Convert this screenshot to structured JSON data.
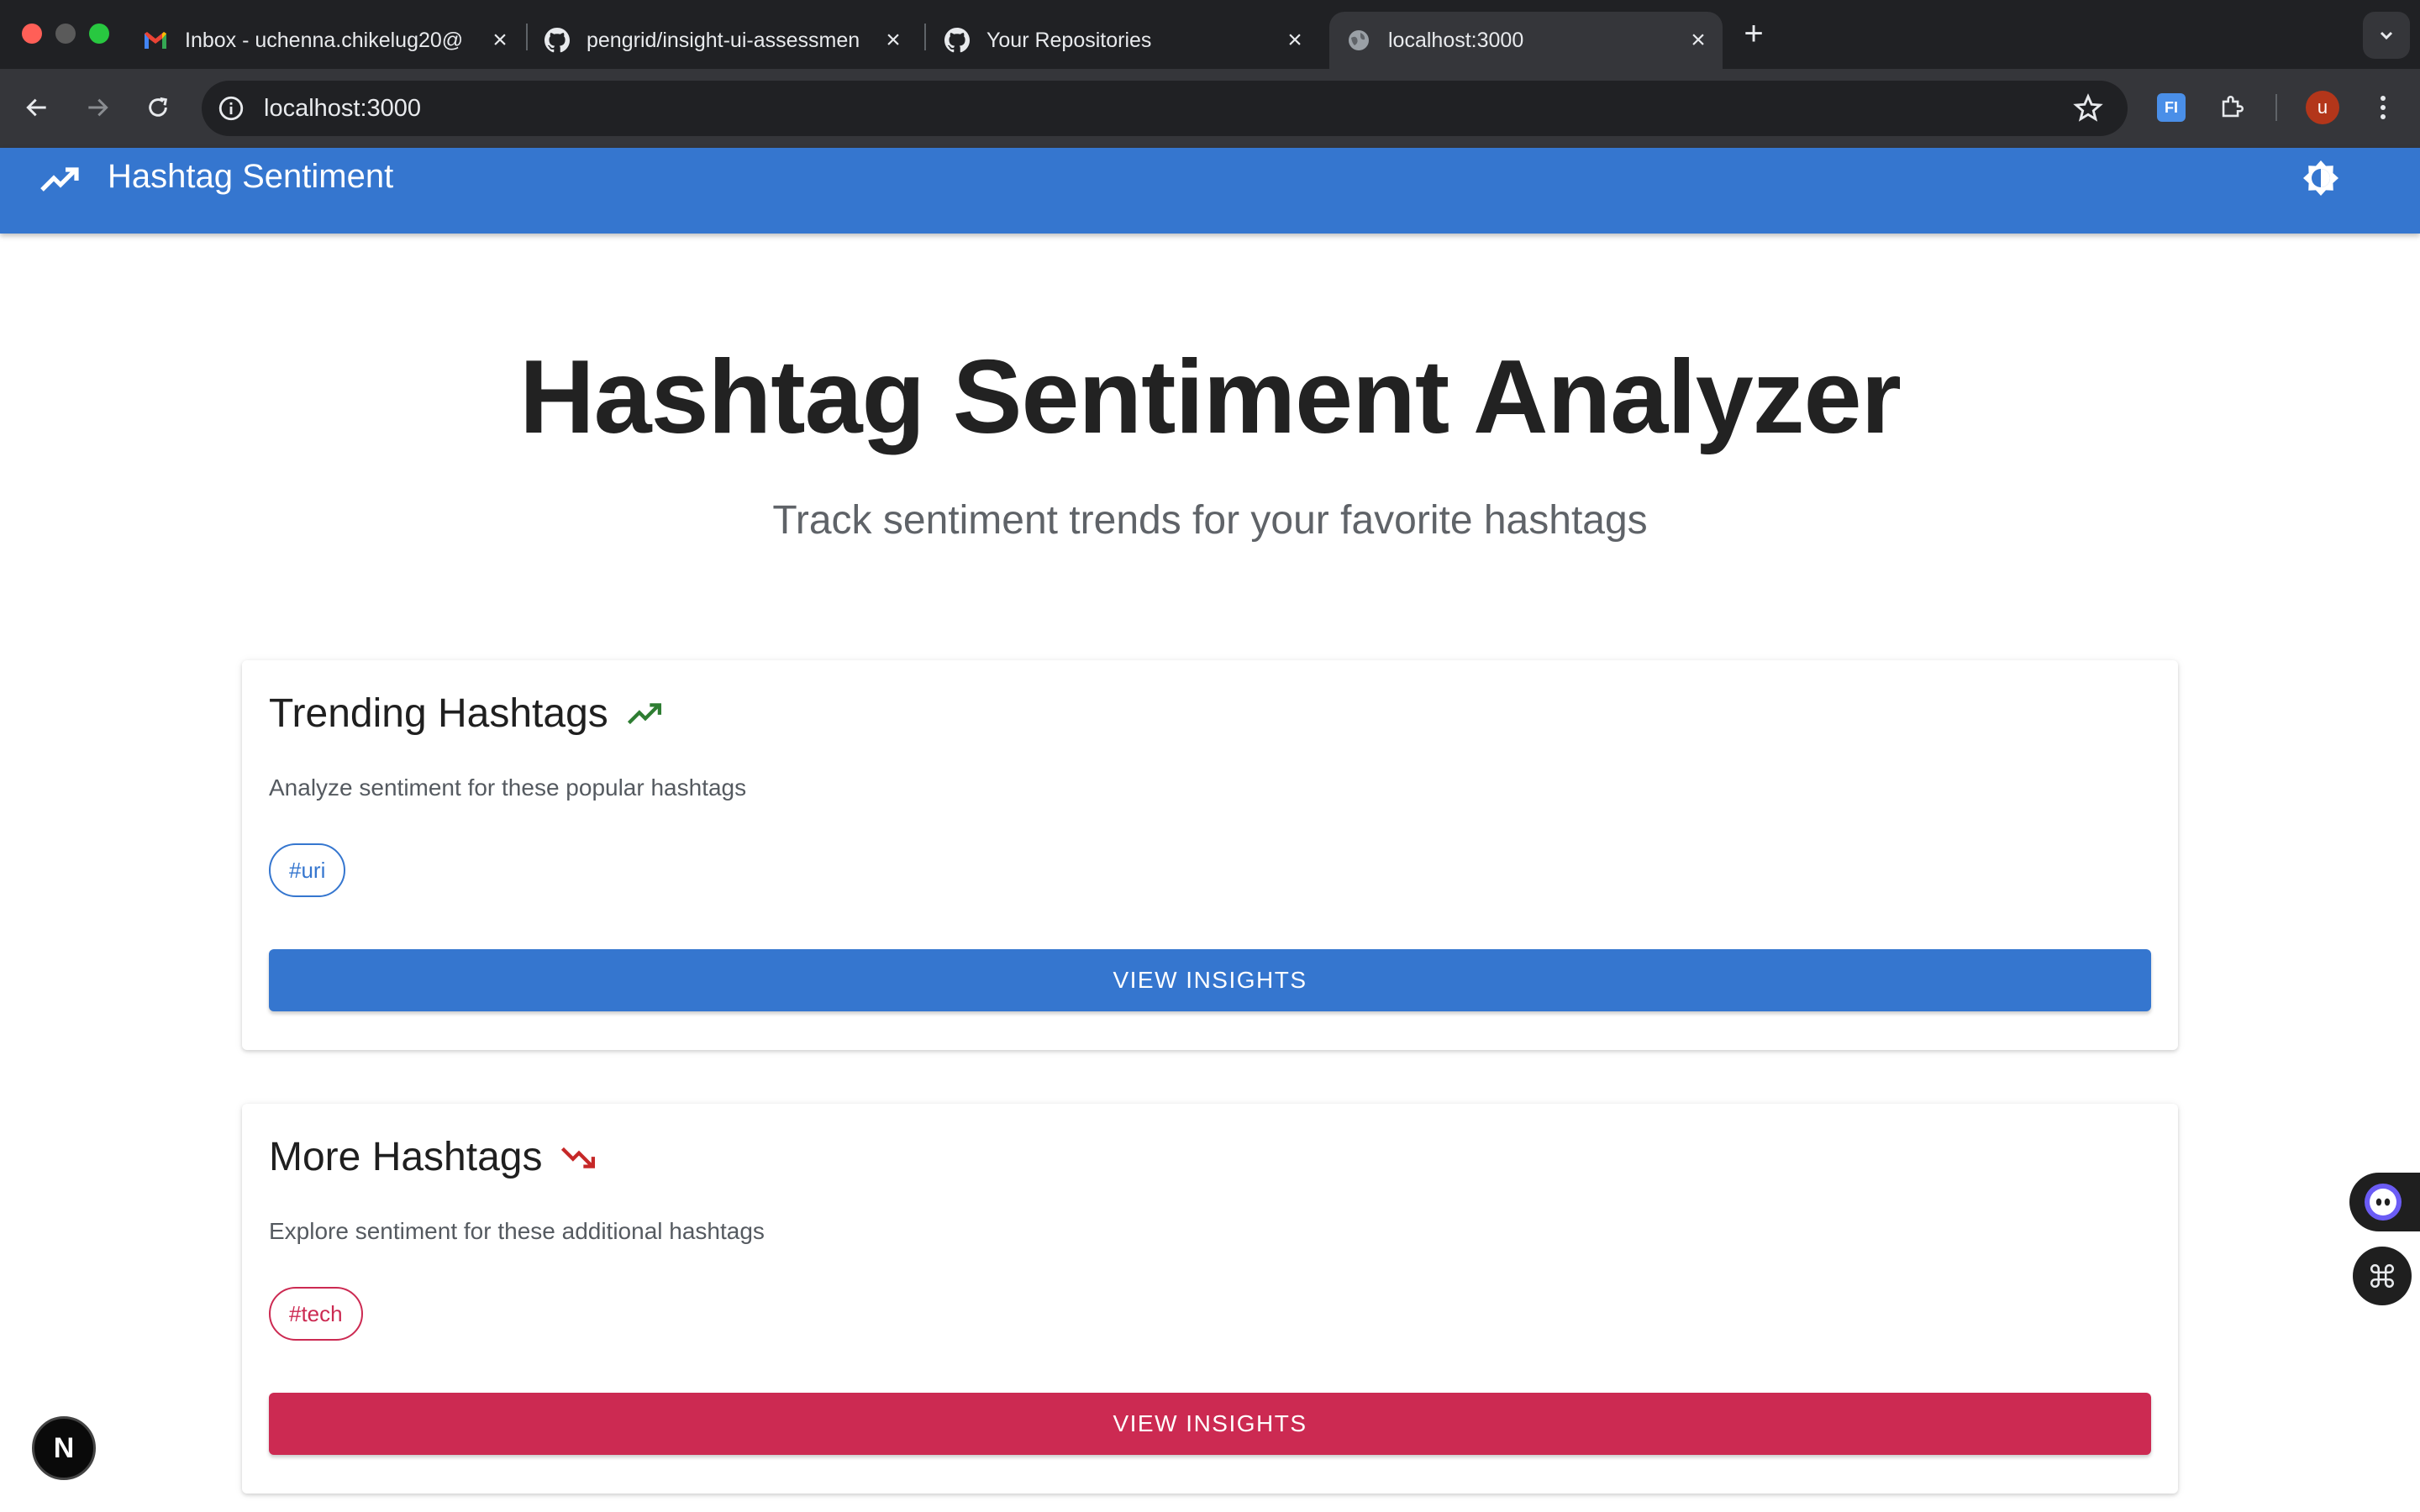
{
  "browser": {
    "tabs": [
      {
        "title": "Inbox - uchenna.chikelug20@",
        "icon": "gmail-icon",
        "active": false
      },
      {
        "title": "pengrid/insight-ui-assessmen",
        "icon": "github-icon",
        "active": false
      },
      {
        "title": "Your Repositories",
        "icon": "github-icon",
        "active": false
      },
      {
        "title": "localhost:3000",
        "icon": "globe-icon",
        "active": true
      }
    ],
    "url": "localhost:3000",
    "profile_initial": "u",
    "extension_label": "FI"
  },
  "app": {
    "title": "Hashtag Sentiment",
    "theme_toggle_icon": "brightness-icon"
  },
  "hero": {
    "title": "Hashtag Sentiment Analyzer",
    "subtitle": "Track sentiment trends for your favorite hashtags"
  },
  "cards": [
    {
      "title": "Trending Hashtags",
      "icon": "trending-up-icon",
      "description": "Analyze sentiment for these popular hashtags",
      "chip": "#uri",
      "button": "VIEW INSIGHTS",
      "accent": "#3576cf"
    },
    {
      "title": "More Hashtags",
      "icon": "trending-down-icon",
      "description": "Explore sentiment for these additional hashtags",
      "chip": "#tech",
      "button": "VIEW INSIGHTS",
      "accent": "#cc2a52"
    }
  ],
  "colors": {
    "appbar": "#3576cf",
    "trend_up": "#2e7d32",
    "trend_down": "#c62828",
    "primary_button": "#3576cf",
    "secondary_button": "#cc2a52"
  },
  "badge": {
    "letter": "N"
  }
}
